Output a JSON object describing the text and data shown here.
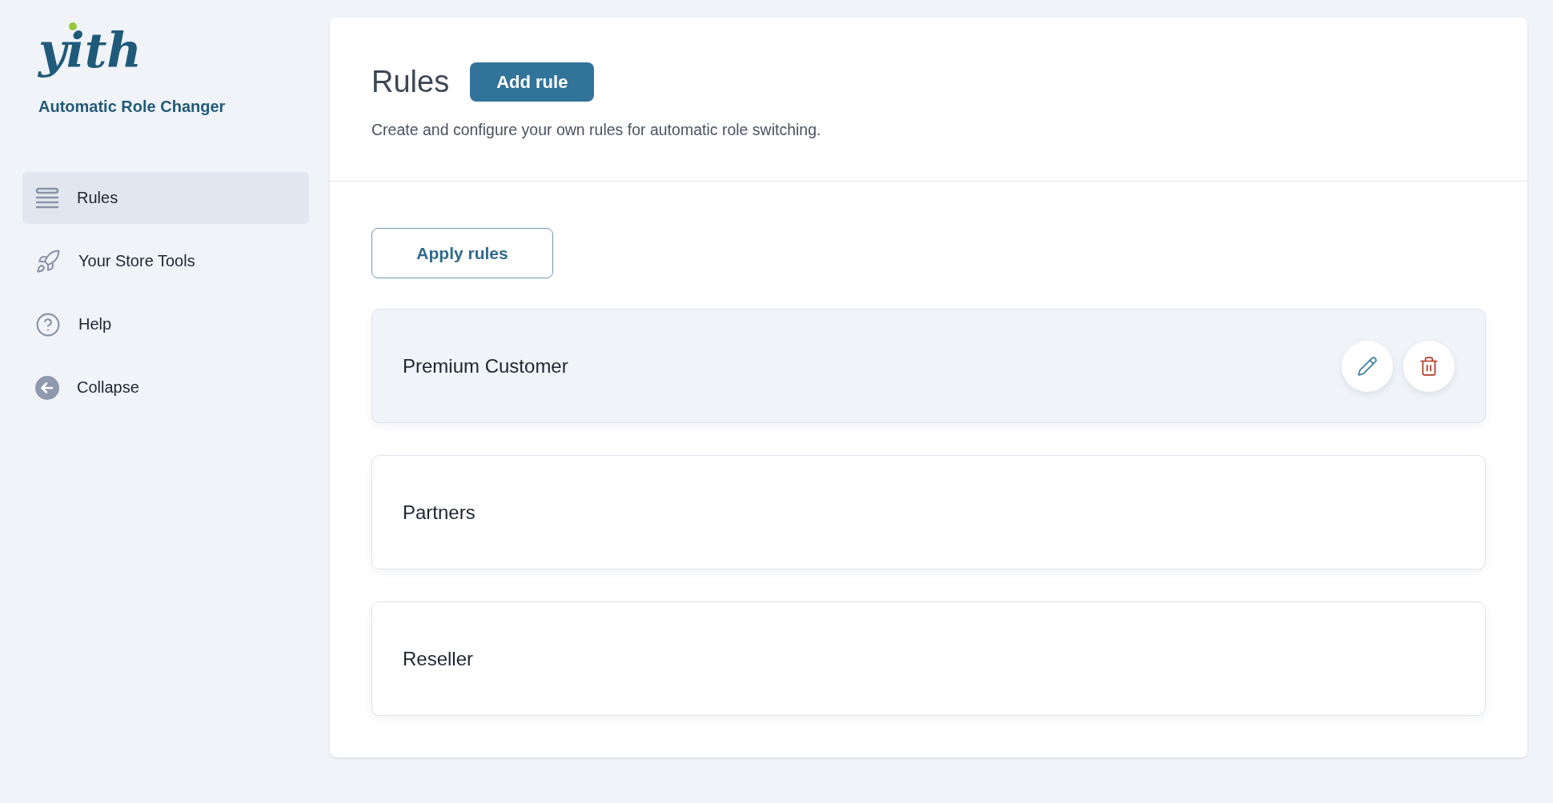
{
  "brand": {
    "logo": "yith",
    "product": "Automatic Role Changer"
  },
  "sidebar": {
    "items": [
      {
        "label": "Rules",
        "selected": true
      },
      {
        "label": "Your Store Tools",
        "selected": false
      },
      {
        "label": "Help",
        "selected": false
      },
      {
        "label": "Collapse",
        "selected": false
      }
    ]
  },
  "header": {
    "title": "Rules",
    "add_button": "Add rule",
    "description": "Create and configure your own rules for automatic role switching."
  },
  "apply_button": "Apply rules",
  "rules": [
    {
      "name": "Premium Customer",
      "hovered": true
    },
    {
      "name": "Partners",
      "hovered": false
    },
    {
      "name": "Reseller",
      "hovered": false
    }
  ]
}
